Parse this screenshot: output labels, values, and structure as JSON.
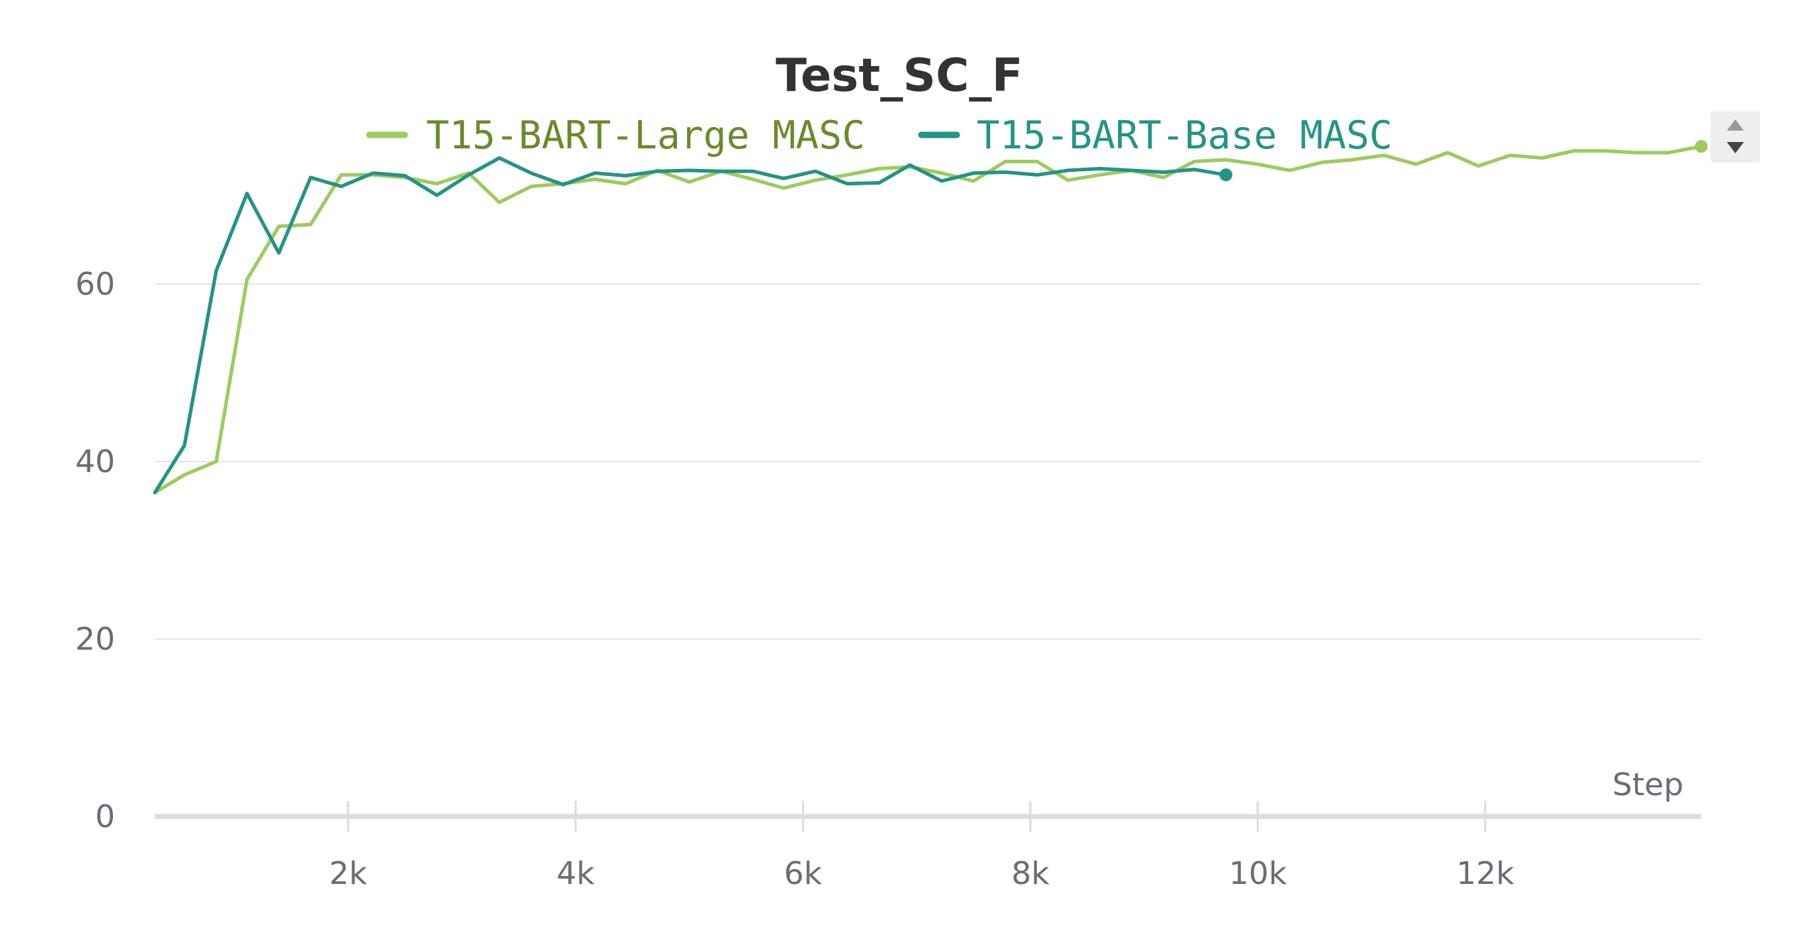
{
  "chart_data": {
    "type": "line",
    "title": "Test_SC_F",
    "xlabel": "Step",
    "ylabel": "",
    "xlim": [
      300,
      13900
    ],
    "ylim": [
      0,
      80
    ],
    "x_ticks": [
      2000,
      4000,
      6000,
      8000,
      10000,
      12000
    ],
    "x_tick_labels": [
      "2k",
      "4k",
      "6k",
      "8k",
      "10k",
      "12k"
    ],
    "y_ticks": [
      0,
      20,
      40,
      60
    ],
    "y_tick_labels": [
      "0",
      "20",
      "40",
      "60"
    ],
    "grid": true,
    "legend_position": "top-center",
    "series": [
      {
        "name": "T15-BART-Large MASC",
        "color": "#9dcb5e",
        "text_color": "#6b8a2c",
        "x": [
          300,
          560,
          840,
          1110,
          1390,
          1670,
          1940,
          2220,
          2500,
          2780,
          3060,
          3330,
          3610,
          3890,
          4170,
          4440,
          4720,
          5000,
          5280,
          5560,
          5830,
          6110,
          6390,
          6670,
          6940,
          7220,
          7500,
          7780,
          8060,
          8330,
          8610,
          8890,
          9170,
          9440,
          9720,
          10000,
          10280,
          10560,
          10830,
          11110,
          11390,
          11670,
          11940,
          12220,
          12500,
          12780,
          13060,
          13330,
          13610,
          13900
        ],
        "y": [
          36.5,
          38.5,
          40,
          60.5,
          66.5,
          66.7,
          72.3,
          72.3,
          72,
          71.3,
          72.5,
          69.2,
          71,
          71.3,
          71.8,
          71.3,
          72.8,
          71.5,
          72.7,
          71.8,
          70.8,
          71.7,
          72.3,
          73,
          73.2,
          72.5,
          71.6,
          73.8,
          73.8,
          71.7,
          72.3,
          72.8,
          72,
          73.8,
          74,
          73.5,
          72.8,
          73.7,
          74,
          74.5,
          73.5,
          74.8,
          73.3,
          74.5,
          74.2,
          75,
          75,
          74.8,
          74.8,
          75.5
        ]
      },
      {
        "name": "T15-BART-Base MASC",
        "color": "#239485",
        "text_color": "#239485",
        "x": [
          300,
          560,
          840,
          1110,
          1390,
          1670,
          1940,
          2220,
          2500,
          2780,
          3060,
          3330,
          3610,
          3890,
          4170,
          4440,
          4720,
          5000,
          5280,
          5560,
          5830,
          6110,
          6390,
          6670,
          6940,
          7220,
          7500,
          7780,
          8060,
          8330,
          8610,
          8890,
          9170,
          9440,
          9720
        ],
        "y": [
          36.5,
          41.8,
          61.5,
          70.2,
          63.5,
          72,
          71,
          72.5,
          72.2,
          70,
          72.3,
          74.2,
          72.5,
          71.2,
          72.5,
          72.2,
          72.7,
          72.8,
          72.7,
          72.7,
          71.9,
          72.7,
          71.3,
          71.4,
          73.4,
          71.6,
          72.5,
          72.6,
          72.3,
          72.8,
          73,
          72.8,
          72.6,
          72.9,
          72.3
        ]
      }
    ]
  }
}
